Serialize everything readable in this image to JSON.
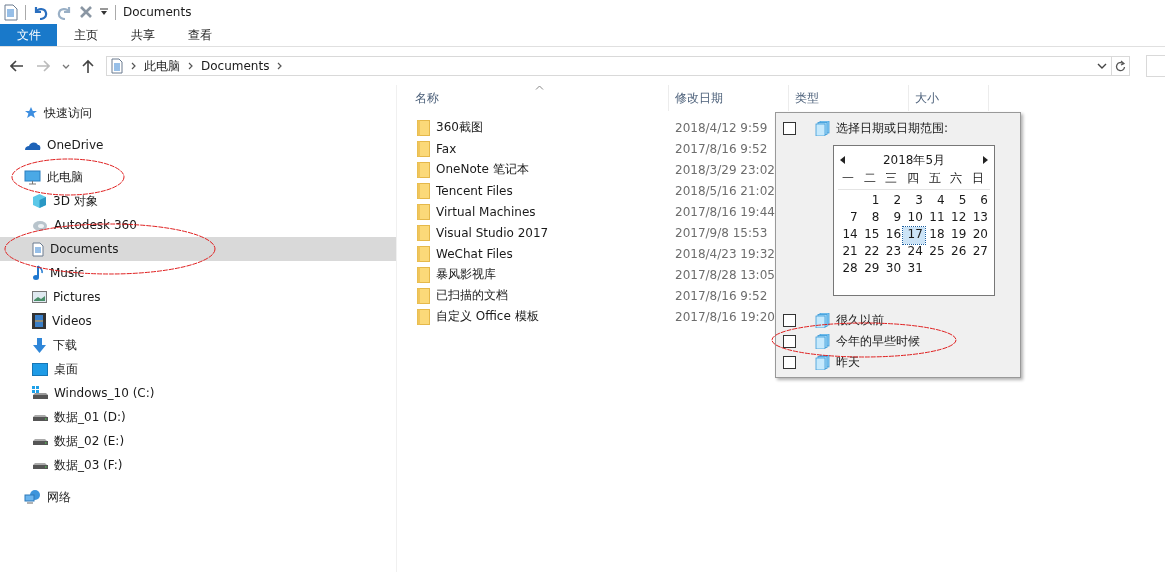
{
  "window": {
    "title": "Documents"
  },
  "ribbon_tabs": [
    {
      "label": "文件",
      "selected": true
    },
    {
      "label": "主页",
      "selected": false
    },
    {
      "label": "共享",
      "selected": false
    },
    {
      "label": "查看",
      "selected": false
    }
  ],
  "address_bar": {
    "path": [
      "此电脑",
      "Documents"
    ]
  },
  "sidebar": {
    "items": [
      {
        "label": "快速访问",
        "selected": false
      },
      {
        "label": "OneDrive",
        "selected": false
      },
      {
        "label": "此电脑",
        "selected": false,
        "children": [
          {
            "label": "3D 对象",
            "selected": false
          },
          {
            "label": "Autodesk 360",
            "selected": false
          },
          {
            "label": "Documents",
            "selected": true
          },
          {
            "label": "Music",
            "selected": false
          },
          {
            "label": "Pictures",
            "selected": false
          },
          {
            "label": "Videos",
            "selected": false
          },
          {
            "label": "下载",
            "selected": false
          },
          {
            "label": "桌面",
            "selected": false
          },
          {
            "label": "Windows_10 (C:)",
            "selected": false
          },
          {
            "label": "数据_01 (D:)",
            "selected": false
          },
          {
            "label": "数据_02 (E:)",
            "selected": false
          },
          {
            "label": "数据_03 (F:)",
            "selected": false
          }
        ]
      },
      {
        "label": "网络",
        "selected": false
      }
    ]
  },
  "table": {
    "columns": [
      "名称",
      "修改日期",
      "类型",
      "大小"
    ],
    "rows": [
      {
        "name": "360截图",
        "modified": "2018/4/12 9:59"
      },
      {
        "name": "Fax",
        "modified": "2017/8/16 9:52"
      },
      {
        "name": "OneNote 笔记本",
        "modified": "2018/3/29 23:02"
      },
      {
        "name": "Tencent Files",
        "modified": "2018/5/16 21:02"
      },
      {
        "name": "Virtual Machines",
        "modified": "2017/8/16 19:44"
      },
      {
        "name": "Visual Studio 2017",
        "modified": "2017/9/8 15:53"
      },
      {
        "name": "WeChat Files",
        "modified": "2018/4/23 19:32"
      },
      {
        "name": "暴风影视库",
        "modified": "2017/8/28 13:05"
      },
      {
        "name": "已扫描的文档",
        "modified": "2017/8/16 9:52"
      },
      {
        "name": "自定义 Office 模板",
        "modified": "2017/8/16 19:20"
      }
    ]
  },
  "date_filter": {
    "options": [
      {
        "label": "选择日期或日期范围:",
        "checked": false,
        "kind": "calendar"
      },
      {
        "label": "很久以前",
        "checked": false,
        "kind": "plain"
      },
      {
        "label": "今年的早些时候",
        "checked": false,
        "kind": "plain"
      },
      {
        "label": "昨天",
        "checked": false,
        "kind": "plain"
      }
    ],
    "calendar": {
      "month": "2018年5月",
      "weekdays": [
        "一",
        "二",
        "三",
        "四",
        "五",
        "六",
        "日"
      ],
      "weeks": [
        [
          {
            "day": "1",
            "selected": false
          },
          {
            "day": "2",
            "selected": false
          },
          {
            "day": "3",
            "selected": false
          },
          {
            "day": "4",
            "selected": false
          },
          {
            "day": "5",
            "selected": false
          },
          {
            "day": "6",
            "selected": false
          }
        ],
        [
          {
            "day": "7",
            "selected": false
          },
          {
            "day": "8",
            "selected": false
          },
          {
            "day": "9",
            "selected": false
          },
          {
            "day": "10",
            "selected": false
          },
          {
            "day": "11",
            "selected": false
          },
          {
            "day": "12",
            "selected": false
          },
          {
            "day": "13",
            "selected": false
          }
        ],
        [
          {
            "day": "14",
            "selected": false
          },
          {
            "day": "15",
            "selected": false
          },
          {
            "day": "16",
            "selected": false
          },
          {
            "day": "17",
            "selected": true
          },
          {
            "day": "18",
            "selected": false
          },
          {
            "day": "19",
            "selected": false
          },
          {
            "day": "20",
            "selected": false
          }
        ],
        [
          {
            "day": "21",
            "selected": false
          },
          {
            "day": "22",
            "selected": false
          },
          {
            "day": "23",
            "selected": false
          },
          {
            "day": "24",
            "selected": false
          },
          {
            "day": "25",
            "selected": false
          },
          {
            "day": "26",
            "selected": false
          },
          {
            "day": "27",
            "selected": false
          }
        ],
        [
          {
            "day": "28",
            "selected": false
          },
          {
            "day": "29",
            "selected": false
          },
          {
            "day": "30",
            "selected": false
          },
          {
            "day": "31",
            "selected": false
          }
        ]
      ]
    }
  }
}
